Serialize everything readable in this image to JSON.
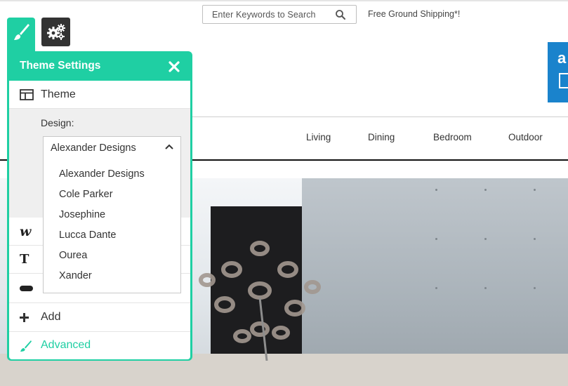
{
  "header": {
    "search_placeholder": "Enter Keywords to Search",
    "shipping_text": "Free Ground Shipping*!",
    "promo_letter": "a"
  },
  "nav": {
    "items": [
      {
        "label": "Living"
      },
      {
        "label": "Dining"
      },
      {
        "label": "Bedroom"
      },
      {
        "label": "Outdoor"
      }
    ]
  },
  "panel": {
    "title": "Theme Settings",
    "theme_label": "Theme",
    "design_label": "Design:",
    "selected_design": "Alexander Designs",
    "design_options": [
      "Alexander Designs",
      "Cole Parker",
      "Josephine",
      "Lucca Dante",
      "Ourea",
      "Xander"
    ],
    "hidden_row_icons": [
      "script-w-icon",
      "text-t-icon",
      "button-shape-icon"
    ],
    "script_icon_glyph": "w",
    "text_icon_glyph": "T",
    "add_label": "Add",
    "advanced_label": "Advanced"
  },
  "colors": {
    "accent": "#1fcfa3",
    "promo_blue": "#1a83cc",
    "gear_tab": "#333333"
  }
}
